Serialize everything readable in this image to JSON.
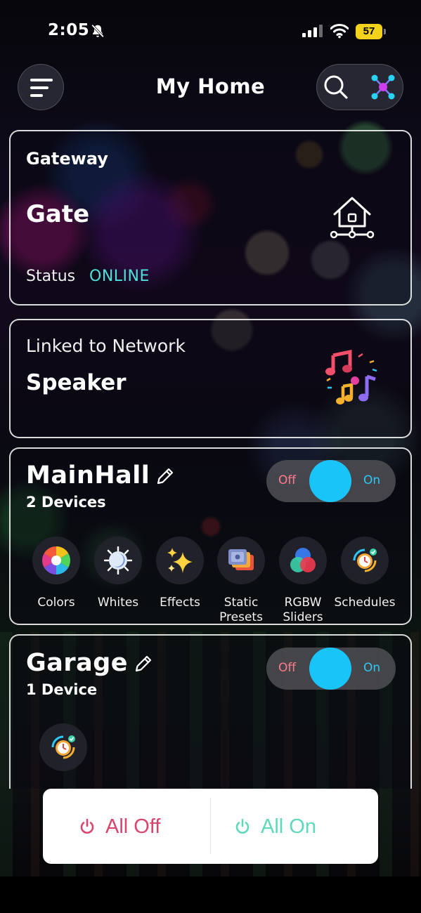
{
  "status_bar": {
    "time": "2:05",
    "battery": "57"
  },
  "header": {
    "title": "My Home"
  },
  "gateway": {
    "label": "Gateway",
    "name": "Gate",
    "status_label": "Status",
    "status_value": "ONLINE"
  },
  "speaker": {
    "label": "Linked to Network",
    "name": "Speaker"
  },
  "rooms": [
    {
      "name": "MainHall",
      "device_count": "2 Devices",
      "toggle": {
        "off_label": "Off",
        "on_label": "On",
        "state": "on"
      },
      "features": [
        {
          "label": "Colors",
          "icon": "color-wheel-icon"
        },
        {
          "label": "Whites",
          "icon": "whites-icon"
        },
        {
          "label": "Effects",
          "icon": "sparkles-icon"
        },
        {
          "label": "Static\nPresets",
          "icon": "presets-icon"
        },
        {
          "label": "RGBW\nSliders",
          "icon": "rgb-circles-icon"
        },
        {
          "label": "Schedules",
          "icon": "schedule-clock-icon"
        }
      ]
    },
    {
      "name": "Garage",
      "device_count": "1 Device",
      "toggle": {
        "off_label": "Off",
        "on_label": "On",
        "state": "on"
      },
      "features": [
        {
          "label": "",
          "icon": "schedule-clock-icon"
        }
      ]
    }
  ],
  "actions": {
    "all_off": "All Off",
    "all_on": "All On"
  },
  "colors": {
    "accent_cyan": "#18c4f8",
    "online": "#4fe0d8",
    "off_pink": "#d8456d",
    "on_green": "#5fd9bc",
    "battery": "#f2d21a"
  }
}
